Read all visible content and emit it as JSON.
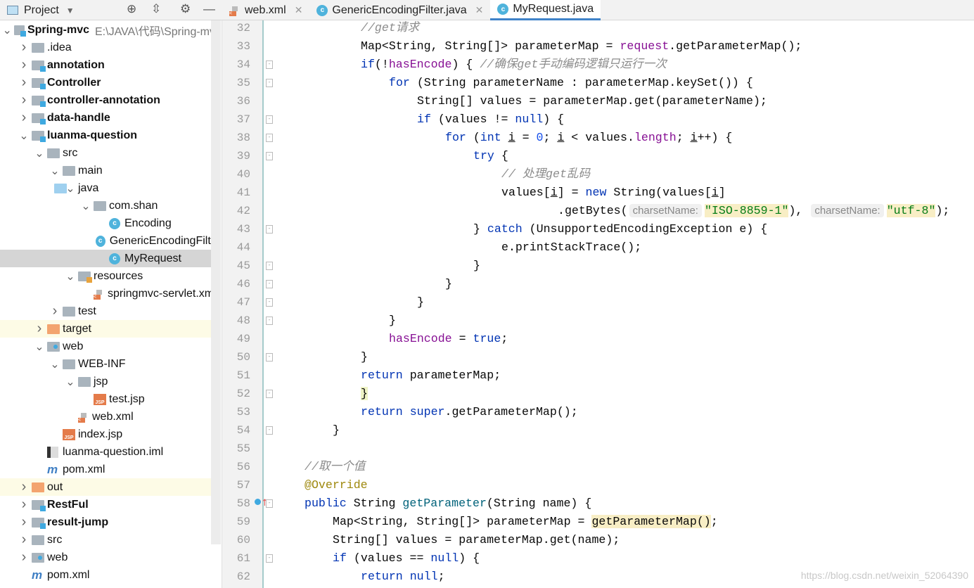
{
  "project_panel": {
    "title": "Project"
  },
  "tabs": [
    {
      "label": "web.xml",
      "icon": "xml-file-icon"
    },
    {
      "label": "GenericEncodingFilter.java",
      "icon": "class-icon"
    },
    {
      "label": "MyRequest.java",
      "icon": "class-icon",
      "active": true
    }
  ],
  "tree": [
    {
      "l": 0,
      "t": "Spring-mvc",
      "bold": true,
      "path": "E:\\JAVA\\代码\\Spring-mvc",
      "ic": "mod",
      "open": true
    },
    {
      "l": 1,
      "t": ".idea",
      "ic": "folder"
    },
    {
      "l": 1,
      "t": "annotation",
      "bold": true,
      "ic": "mod"
    },
    {
      "l": 1,
      "t": "Controller",
      "bold": true,
      "ic": "mod"
    },
    {
      "l": 1,
      "t": "controller-annotation",
      "bold": true,
      "ic": "mod"
    },
    {
      "l": 1,
      "t": "data-handle",
      "bold": true,
      "ic": "mod"
    },
    {
      "l": 1,
      "t": "luanma-question",
      "bold": true,
      "ic": "mod",
      "open": true
    },
    {
      "l": 2,
      "t": "src",
      "ic": "folder",
      "open": true
    },
    {
      "l": 3,
      "t": "main",
      "ic": "folder",
      "open": true
    },
    {
      "l": 4,
      "t": "java",
      "ic": "src",
      "open": true
    },
    {
      "l": 5,
      "t": "com.shan",
      "ic": "folder",
      "open": true
    },
    {
      "l": 6,
      "t": "Encoding",
      "ic": "class",
      "leaf": true
    },
    {
      "l": 6,
      "t": "GenericEncodingFilter",
      "ic": "class",
      "leaf": true
    },
    {
      "l": 6,
      "t": "MyRequest",
      "ic": "class",
      "leaf": true,
      "sel": true
    },
    {
      "l": 4,
      "t": "resources",
      "ic": "res",
      "open": true
    },
    {
      "l": 5,
      "t": "springmvc-servlet.xml",
      "ic": "xml",
      "leaf": true
    },
    {
      "l": 3,
      "t": "test",
      "ic": "folder"
    },
    {
      "l": 2,
      "t": "target",
      "ic": "orange",
      "ex": true
    },
    {
      "l": 2,
      "t": "web",
      "ic": "web",
      "open": true
    },
    {
      "l": 3,
      "t": "WEB-INF",
      "ic": "folder",
      "open": true
    },
    {
      "l": 4,
      "t": "jsp",
      "ic": "folder",
      "open": true
    },
    {
      "l": 5,
      "t": "test.jsp",
      "ic": "jsp",
      "leaf": true
    },
    {
      "l": 4,
      "t": "web.xml",
      "ic": "xml",
      "leaf": true
    },
    {
      "l": 3,
      "t": "index.jsp",
      "ic": "jsp",
      "leaf": true
    },
    {
      "l": 2,
      "t": "luanma-question.iml",
      "ic": "iml",
      "leaf": true
    },
    {
      "l": 2,
      "t": "pom.xml",
      "ic": "mvn",
      "leaf": true
    },
    {
      "l": 1,
      "t": "out",
      "ic": "orange",
      "ex": true
    },
    {
      "l": 1,
      "t": "RestFul",
      "bold": true,
      "ic": "mod"
    },
    {
      "l": 1,
      "t": "result-jump",
      "bold": true,
      "ic": "mod"
    },
    {
      "l": 1,
      "t": "src",
      "ic": "folder"
    },
    {
      "l": 1,
      "t": "web",
      "ic": "web"
    },
    {
      "l": 1,
      "t": "pom.xml",
      "ic": "mvn",
      "leaf": true
    }
  ],
  "code": [
    {
      "n": 32,
      "i": 12,
      "t": [
        [
          "c",
          "//get请求"
        ]
      ]
    },
    {
      "n": 33,
      "i": 12,
      "t": [
        [
          "",
          "Map<String, String[]> parameterMap = "
        ],
        [
          "f",
          "request"
        ],
        [
          "",
          ".getParameterMap();"
        ]
      ]
    },
    {
      "n": 34,
      "i": 12,
      "fold": true,
      "t": [
        [
          "k",
          "if"
        ],
        [
          "",
          "(!"
        ],
        [
          "f",
          "hasEncode"
        ],
        [
          "",
          ") { "
        ],
        [
          "c",
          "//确保get手动编码逻辑只运行一次"
        ]
      ]
    },
    {
      "n": 35,
      "i": 16,
      "fold": true,
      "t": [
        [
          "k",
          "for"
        ],
        [
          "",
          " (String parameterName : parameterMap.keySet()) {"
        ]
      ]
    },
    {
      "n": 36,
      "i": 20,
      "t": [
        [
          "",
          "String[] values = parameterMap.get(parameterName);"
        ]
      ]
    },
    {
      "n": 37,
      "i": 20,
      "fold": true,
      "t": [
        [
          "k",
          "if"
        ],
        [
          "",
          " (values != "
        ],
        [
          "k",
          "null"
        ],
        [
          "",
          ") {"
        ]
      ]
    },
    {
      "n": 38,
      "i": 24,
      "fold": true,
      "t": [
        [
          "k",
          "for"
        ],
        [
          "",
          " ("
        ],
        [
          "k",
          "int"
        ],
        [
          "",
          " "
        ],
        [
          "u",
          "i"
        ],
        [
          "",
          " = "
        ],
        [
          "n",
          "0"
        ],
        [
          "",
          "; "
        ],
        [
          "u",
          "i"
        ],
        [
          "",
          " < values."
        ],
        [
          "f",
          "length"
        ],
        [
          "",
          "; "
        ],
        [
          "u",
          "i"
        ],
        [
          "",
          "++) {"
        ]
      ]
    },
    {
      "n": 39,
      "i": 28,
      "fold": true,
      "t": [
        [
          "k",
          "try"
        ],
        [
          "",
          " {"
        ]
      ]
    },
    {
      "n": 40,
      "i": 32,
      "t": [
        [
          "c",
          "// 处理get乱码"
        ]
      ]
    },
    {
      "n": 41,
      "i": 32,
      "t": [
        [
          "",
          "values["
        ],
        [
          "u",
          "i"
        ],
        [
          "",
          "] = "
        ],
        [
          "k",
          "new"
        ],
        [
          "",
          " String(values["
        ],
        [
          "u",
          "i"
        ],
        [
          "",
          "]"
        ]
      ]
    },
    {
      "n": 42,
      "i": 40,
      "t": [
        [
          "",
          ".getBytes("
        ],
        [
          "h",
          "charsetName:"
        ],
        [
          "s",
          "\"ISO-8859-1\""
        ],
        [
          "",
          "), "
        ],
        [
          "h",
          "charsetName:"
        ],
        [
          "s",
          "\"utf-8\""
        ],
        [
          "",
          ");"
        ]
      ]
    },
    {
      "n": 43,
      "i": 28,
      "fold": true,
      "t": [
        [
          "",
          "} "
        ],
        [
          "k",
          "catch"
        ],
        [
          "",
          " (UnsupportedEncodingException e) {"
        ]
      ]
    },
    {
      "n": 44,
      "i": 32,
      "t": [
        [
          "",
          "e.printStackTrace();"
        ]
      ]
    },
    {
      "n": 45,
      "i": 28,
      "fold": true,
      "t": [
        [
          "",
          "}"
        ]
      ]
    },
    {
      "n": 46,
      "i": 24,
      "fold": true,
      "t": [
        [
          "",
          "}"
        ]
      ]
    },
    {
      "n": 47,
      "i": 20,
      "fold": true,
      "t": [
        [
          "",
          "}"
        ]
      ]
    },
    {
      "n": 48,
      "i": 16,
      "fold": true,
      "t": [
        [
          "",
          "}"
        ]
      ]
    },
    {
      "n": 49,
      "i": 16,
      "t": [
        [
          "f",
          "hasEncode"
        ],
        [
          "",
          " = "
        ],
        [
          "k",
          "true"
        ],
        [
          "",
          ";"
        ]
      ]
    },
    {
      "n": 50,
      "i": 12,
      "fold": true,
      "t": [
        [
          "",
          "}"
        ]
      ]
    },
    {
      "n": 51,
      "i": 12,
      "t": [
        [
          "k",
          "return"
        ],
        [
          "",
          " parameterMap;"
        ]
      ]
    },
    {
      "n": 52,
      "i": 12,
      "fold": true,
      "t": [
        [
          "br",
          "}"
        ]
      ]
    },
    {
      "n": 53,
      "i": 12,
      "t": [
        [
          "k",
          "return"
        ],
        [
          "",
          " "
        ],
        [
          "k",
          "super"
        ],
        [
          "",
          ".getParameterMap();"
        ]
      ]
    },
    {
      "n": 54,
      "i": 8,
      "fold": true,
      "t": [
        [
          "",
          "}"
        ]
      ]
    },
    {
      "n": 55,
      "i": 0,
      "t": []
    },
    {
      "n": 56,
      "i": 4,
      "t": [
        [
          "c",
          "//取一个值"
        ]
      ]
    },
    {
      "n": 57,
      "i": 4,
      "t": [
        [
          "a",
          "@Override"
        ]
      ]
    },
    {
      "n": 58,
      "i": 4,
      "fold": true,
      "override": true,
      "t": [
        [
          "k",
          "public"
        ],
        [
          "",
          " String "
        ],
        [
          "m",
          "getParameter"
        ],
        [
          "",
          "(String name) {"
        ]
      ]
    },
    {
      "n": 59,
      "i": 8,
      "t": [
        [
          "",
          "Map<String, String[]> parameterMap = "
        ],
        [
          "hl",
          "getParameterMap()"
        ],
        [
          "",
          ";"
        ]
      ]
    },
    {
      "n": 60,
      "i": 8,
      "t": [
        [
          "",
          "String[] values = parameterMap.get(name);"
        ]
      ]
    },
    {
      "n": 61,
      "i": 8,
      "fold": true,
      "t": [
        [
          "k",
          "if"
        ],
        [
          "",
          " (values == "
        ],
        [
          "k",
          "null"
        ],
        [
          "",
          ") {"
        ]
      ]
    },
    {
      "n": 62,
      "i": 12,
      "t": [
        [
          "k",
          "return"
        ],
        [
          "",
          " "
        ],
        [
          "k",
          "null"
        ],
        [
          "",
          ";"
        ]
      ]
    }
  ],
  "watermark": "https://blog.csdn.net/weixin_52064390",
  "colors": {
    "keyword": "#0033b3",
    "field": "#871094",
    "comment": "#8c8c8c",
    "string": "#067d17",
    "accent": "#4083c9"
  }
}
